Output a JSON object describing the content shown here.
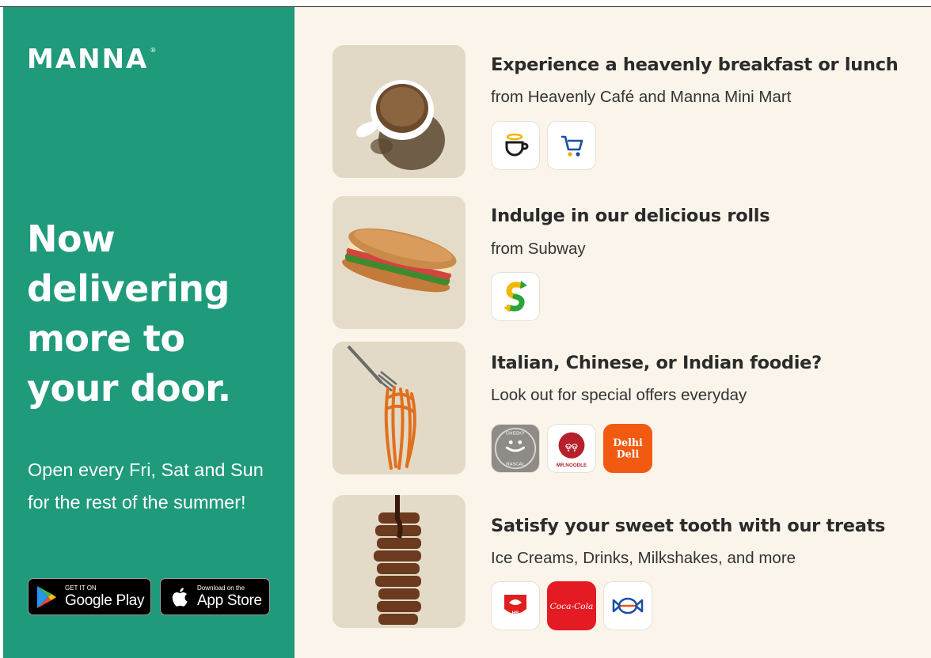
{
  "brand": {
    "name": "MANNA",
    "mark": "®",
    "primary_color": "#1f9a7a",
    "background_color": "#faf4ea"
  },
  "hero": {
    "headline": "Now delivering more to your door.",
    "subtext": "Open every Fri, Sat and Sun for the rest of the summer!"
  },
  "stores": {
    "google_play": {
      "small": "GET IT ON",
      "big": "Google Play",
      "icon": "google-play-icon"
    },
    "app_store": {
      "small": "Download on the",
      "big": "App Store",
      "icon": "apple-icon"
    }
  },
  "offers": [
    {
      "title": "Experience a heavenly breakfast or lunch",
      "subtitle": "from Heavenly Café and Manna Mini Mart",
      "image": "coffee-cup-photo",
      "logos": [
        "heavenly-cafe-logo",
        "manna-mini-mart-logo"
      ]
    },
    {
      "title": "Indulge in our delicious rolls",
      "subtitle": "from Subway",
      "image": "sub-sandwich-photo",
      "logos": [
        "subway-logo"
      ]
    },
    {
      "title": "Italian, Chinese, or Indian foodie?",
      "subtitle": "Look out for special offers everyday",
      "image": "spaghetti-fork-photo",
      "logos": [
        "cheeky-rascal-logo",
        "mr-noodle-logo",
        "delhi-deli-logo"
      ],
      "logo_texts": {
        "cheeky": "CHEEKY",
        "rascal": "RASCAL",
        "noodle": "MR.NOODLE",
        "delhi": "Delhi",
        "deli": "Deli"
      }
    },
    {
      "title": "Satisfy your sweet tooth with our treats",
      "subtitle": "Ice Creams, Drinks, Milkshakes, and more",
      "image": "waffle-stack-photo",
      "logos": [
        "hb-ice-cream-logo",
        "coca-cola-logo",
        "candy-logo"
      ],
      "logo_texts": {
        "hb": "HB",
        "coke": "Coca-Cola"
      }
    }
  ]
}
